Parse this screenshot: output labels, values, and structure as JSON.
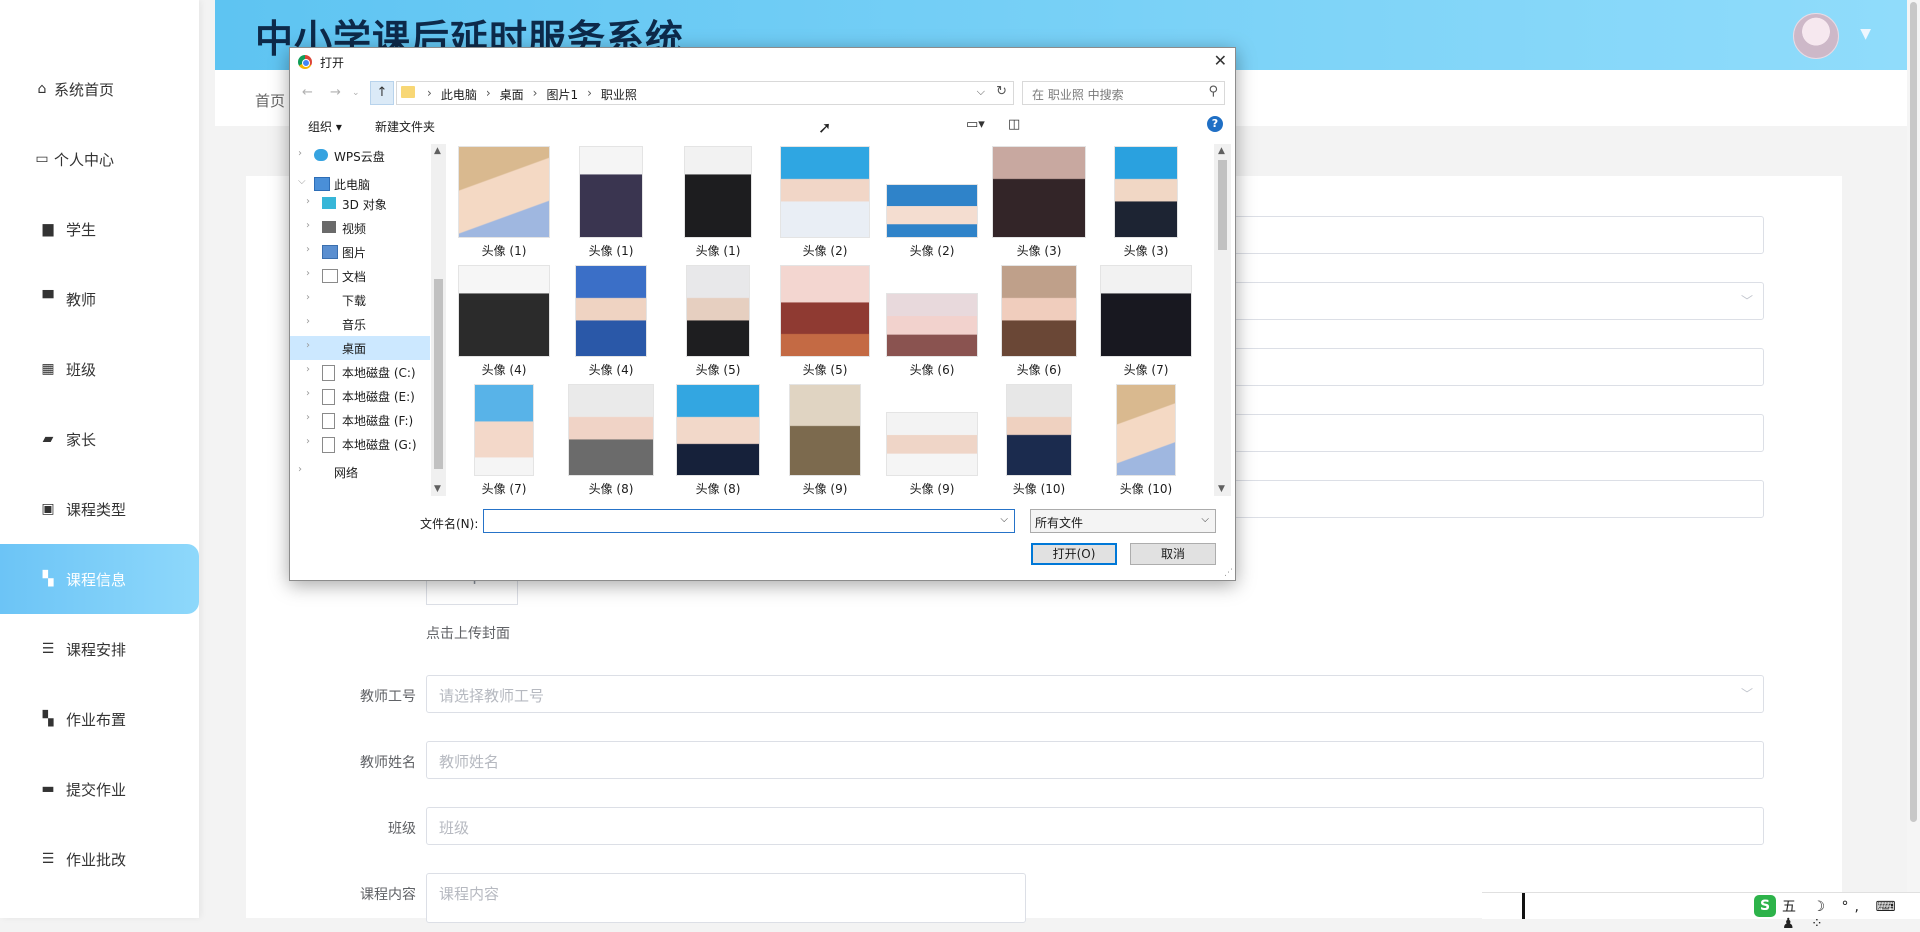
{
  "app": {
    "title": "中小学课后延时服务系统"
  },
  "sidebar": {
    "items": [
      {
        "label": "系统首页",
        "icon": "home-icon"
      },
      {
        "label": "个人中心",
        "icon": "card-icon"
      },
      {
        "label": "学生",
        "icon": "folder-icon"
      },
      {
        "label": "教师",
        "icon": "monitor-icon"
      },
      {
        "label": "班级",
        "icon": "grid-icon"
      },
      {
        "label": "家长",
        "icon": "ticket-icon"
      },
      {
        "label": "课程类型",
        "icon": "clipboard-icon"
      },
      {
        "label": "课程信息",
        "icon": "apps-icon",
        "active": true
      },
      {
        "label": "课程安排",
        "icon": "list-icon"
      },
      {
        "label": "作业布置",
        "icon": "apps-icon"
      },
      {
        "label": "提交作业",
        "icon": "inbox-icon"
      },
      {
        "label": "作业批改",
        "icon": "list-icon"
      }
    ]
  },
  "breadcrumb": {
    "home": "首页"
  },
  "form": {
    "upload_hint": "点击上传封面",
    "upload_plus": "+",
    "fields": [
      {
        "label": "教师工号",
        "placeholder": "请选择教师工号",
        "type": "select"
      },
      {
        "label": "教师姓名",
        "placeholder": "教师姓名",
        "type": "input"
      },
      {
        "label": "班级",
        "placeholder": "班级",
        "type": "input"
      },
      {
        "label": "课程内容",
        "placeholder": "课程内容",
        "type": "textarea"
      }
    ]
  },
  "dialog": {
    "title": "打开",
    "path": [
      "此电脑",
      "桌面",
      "图片1",
      "职业照"
    ],
    "search_placeholder": "在 职业照 中搜索",
    "toolbar": {
      "organize": "组织 ▾",
      "new_folder": "新建文件夹"
    },
    "tree": [
      {
        "label": "WPS云盘",
        "icon": "cloud-icon",
        "indent": 0
      },
      {
        "label": "此电脑",
        "icon": "computer-icon",
        "indent": 0,
        "expanded": true
      },
      {
        "label": "3D 对象",
        "icon": "cube-icon",
        "indent": 1
      },
      {
        "label": "视频",
        "icon": "video-icon",
        "indent": 1
      },
      {
        "label": "图片",
        "icon": "picture-icon",
        "indent": 1
      },
      {
        "label": "文档",
        "icon": "document-icon",
        "indent": 1
      },
      {
        "label": "下载",
        "icon": "download-icon",
        "indent": 1
      },
      {
        "label": "音乐",
        "icon": "music-icon",
        "indent": 1
      },
      {
        "label": "桌面",
        "icon": "desktop-icon",
        "indent": 1,
        "selected": true
      },
      {
        "label": "本地磁盘 (C:)",
        "icon": "drive-icon",
        "indent": 1
      },
      {
        "label": "本地磁盘 (E:)",
        "icon": "drive-icon",
        "indent": 1
      },
      {
        "label": "本地磁盘 (F:)",
        "icon": "drive-icon",
        "indent": 1
      },
      {
        "label": "本地磁盘 (G:)",
        "icon": "drive-icon",
        "indent": 1
      },
      {
        "label": "网络",
        "icon": "network-icon",
        "indent": 0
      }
    ],
    "files": [
      "头像 (1)",
      "头像 (1)",
      "头像 (1)",
      "头像 (2)",
      "头像 (2)",
      "头像 (3)",
      "头像 (3)",
      "头像 (4)",
      "头像 (4)",
      "头像 (5)",
      "头像 (5)",
      "头像 (6)",
      "头像 (6)",
      "头像 (7)",
      "头像 (7)",
      "头像 (8)",
      "头像 (8)",
      "头像 (9)",
      "头像 (9)",
      "头像 (10)",
      "头像 (10)"
    ],
    "filename_label": "文件名(N):",
    "filename_value": "",
    "filetype": "所有文件",
    "open_button": "打开(O)",
    "cancel_button": "取消"
  },
  "ime": {
    "logo": "S",
    "items": "五 ☽ °, ⌨ ♟ ⁘"
  },
  "colors": {
    "accent": "#6cc4f6",
    "header_start": "#5ec4f2",
    "header_end": "#90dcfb",
    "title": "#0d2a4a"
  }
}
